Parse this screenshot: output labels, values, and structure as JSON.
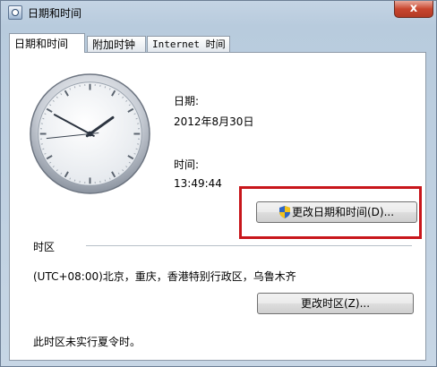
{
  "window": {
    "title": "日期和时间",
    "close_label": "x"
  },
  "tabs": [
    {
      "label": "日期和时间",
      "active": true
    },
    {
      "label": "附加时钟",
      "active": false
    },
    {
      "label": "Internet 时间",
      "active": false
    }
  ],
  "datetime": {
    "date_label": "日期:",
    "date_value": "2012年8月30日",
    "time_label": "时间:",
    "time_value": "13:49:44",
    "change_datetime_button": "更改日期和时间(D)..."
  },
  "clock": {
    "hours": 13,
    "minutes": 49,
    "seconds": 44
  },
  "timezone": {
    "heading": "时区",
    "value": "(UTC+08:00)北京，重庆，香港特别行政区，乌鲁木齐",
    "change_timezone_button": "更改时区(Z)...",
    "dst_note": "此时区未实行夏令时。"
  },
  "colors": {
    "highlight": "#c8161b",
    "window_frame": "#b8cbdd"
  }
}
